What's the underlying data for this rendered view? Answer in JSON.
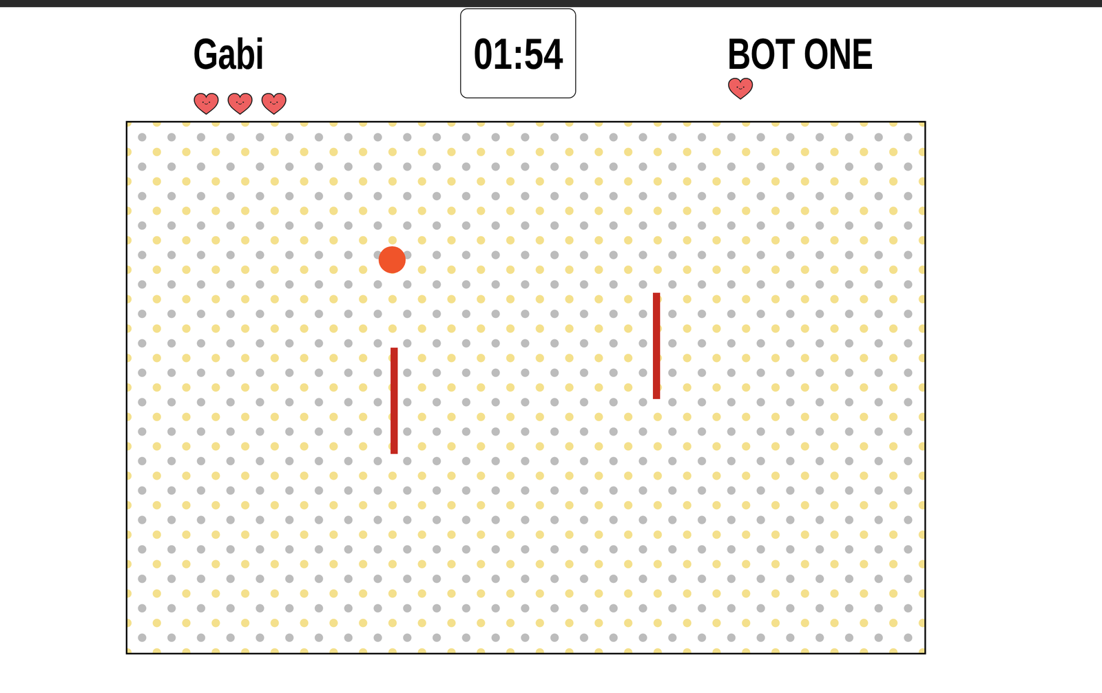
{
  "players": [
    {
      "name": "Gabi",
      "lives": 3
    },
    {
      "name": "BOT ONE",
      "lives": 1
    }
  ],
  "timer": "01:54"
}
